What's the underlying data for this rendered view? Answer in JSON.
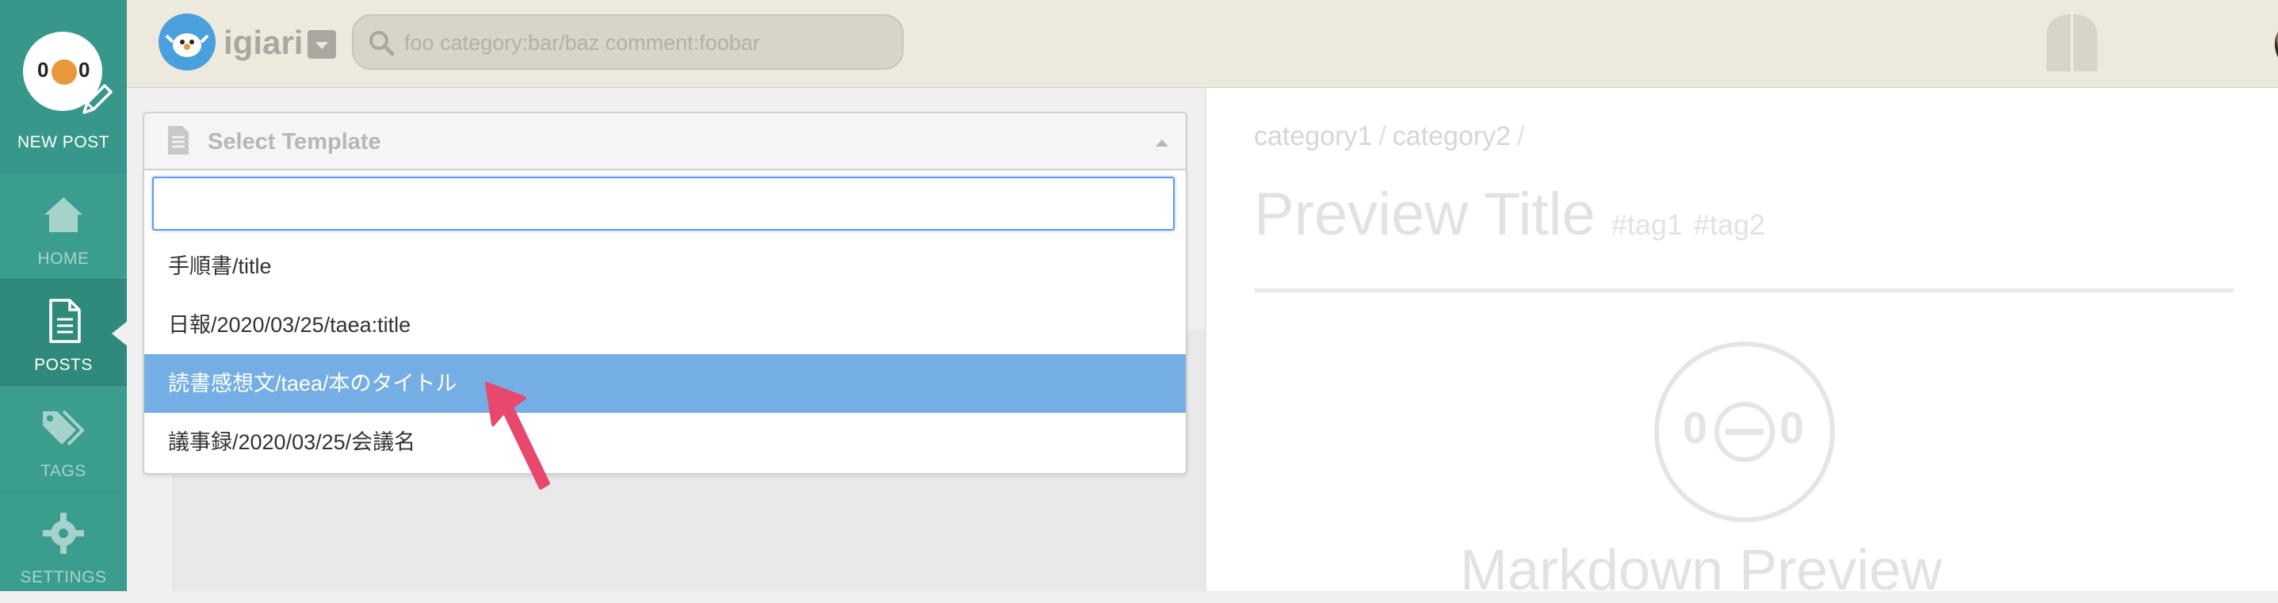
{
  "sidebar": {
    "new_post": "NEW POST",
    "items": [
      {
        "label": "HOME",
        "icon": "home-icon"
      },
      {
        "label": "POSTS",
        "icon": "posts-icon"
      },
      {
        "label": "TAGS",
        "icon": "tags-icon"
      },
      {
        "label": "SETTINGS",
        "icon": "gear-icon"
      }
    ],
    "logo_eye": "0"
  },
  "header": {
    "brand": "igiari",
    "search_placeholder": "foo category:bar/baz comment:foobar"
  },
  "template_select": {
    "label": "Select Template",
    "search_value": "",
    "options": [
      "手順書/title",
      "日報/2020/03/25/taea:title",
      "読書感想文/taea/本のタイトル",
      "議事録/2020/03/25/会議名"
    ],
    "selected_index": 2
  },
  "preview": {
    "breadcrumb": [
      "category1",
      "category2"
    ],
    "breadcrumb_sep": "/",
    "title": "Preview Title",
    "tags": [
      "#tag1",
      "#tag2"
    ],
    "markdown_label": "Markdown Preview",
    "logo_eye": "0"
  },
  "colors": {
    "sidebar": "#3a9d8e",
    "header": "#ede9dd",
    "selected_option": "#74aee4",
    "pointer": "#e8476e"
  }
}
